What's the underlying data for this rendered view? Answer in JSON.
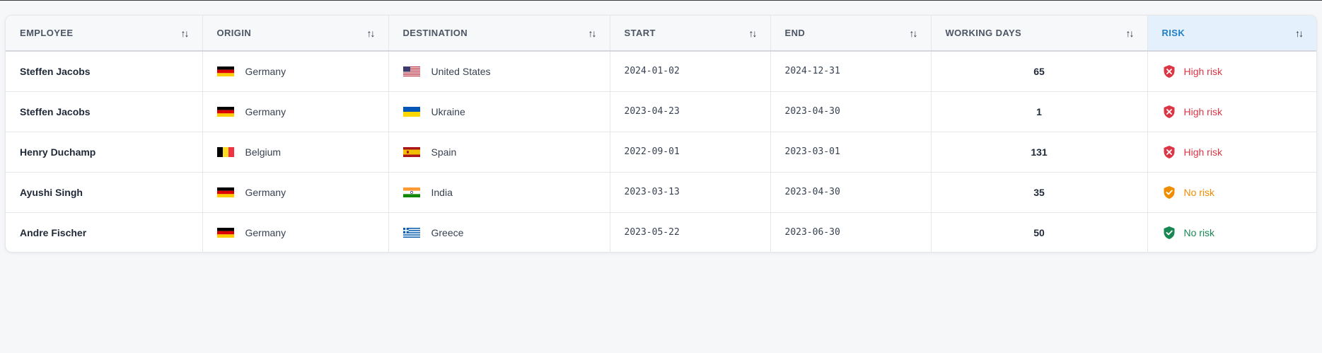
{
  "columns": [
    {
      "label": "EMPLOYEE"
    },
    {
      "label": "ORIGIN"
    },
    {
      "label": "DESTINATION"
    },
    {
      "label": "START"
    },
    {
      "label": "END"
    },
    {
      "label": "WORKING DAYS"
    },
    {
      "label": "RISK",
      "active": true
    }
  ],
  "sort_icon": "↑↓",
  "colors": {
    "accent": "#1f7fc9",
    "high_risk": "#dc3545",
    "no_risk_warn": "#f08c00",
    "no_risk_safe": "#198754"
  },
  "rows": [
    {
      "employee": "Steffen Jacobs",
      "origin": "Germany",
      "origin_flag": "germany-flag-icon",
      "destination": "United States",
      "destination_flag": "united-states-flag-icon",
      "start": "2024-01-02",
      "end": "2024-12-31",
      "working_days": "65",
      "risk": "High risk",
      "risk_icon": "shield-x-icon"
    },
    {
      "employee": "Steffen Jacobs",
      "origin": "Germany",
      "origin_flag": "germany-flag-icon",
      "destination": "Ukraine",
      "destination_flag": "ukraine-flag-icon",
      "start": "2023-04-23",
      "end": "2023-04-30",
      "working_days": "1",
      "risk": "High risk",
      "risk_icon": "shield-x-icon"
    },
    {
      "employee": "Henry Duchamp",
      "origin": "Belgium",
      "origin_flag": "belgium-flag-icon",
      "destination": "Spain",
      "destination_flag": "spain-flag-icon",
      "start": "2022-09-01",
      "end": "2023-03-01",
      "working_days": "131",
      "risk": "High risk",
      "risk_icon": "shield-x-icon"
    },
    {
      "employee": "Ayushi Singh",
      "origin": "Germany",
      "origin_flag": "germany-flag-icon",
      "destination": "India",
      "destination_flag": "india-flag-icon",
      "start": "2023-03-13",
      "end": "2023-04-30",
      "working_days": "35",
      "risk": "No risk",
      "risk_icon": "shield-check-icon"
    },
    {
      "employee": "Andre Fischer",
      "origin": "Germany",
      "origin_flag": "germany-flag-icon",
      "destination": "Greece",
      "destination_flag": "greece-flag-icon",
      "start": "2023-05-22",
      "end": "2023-06-30",
      "working_days": "50",
      "risk": "No risk",
      "risk_icon": "shield-check-icon"
    }
  ]
}
